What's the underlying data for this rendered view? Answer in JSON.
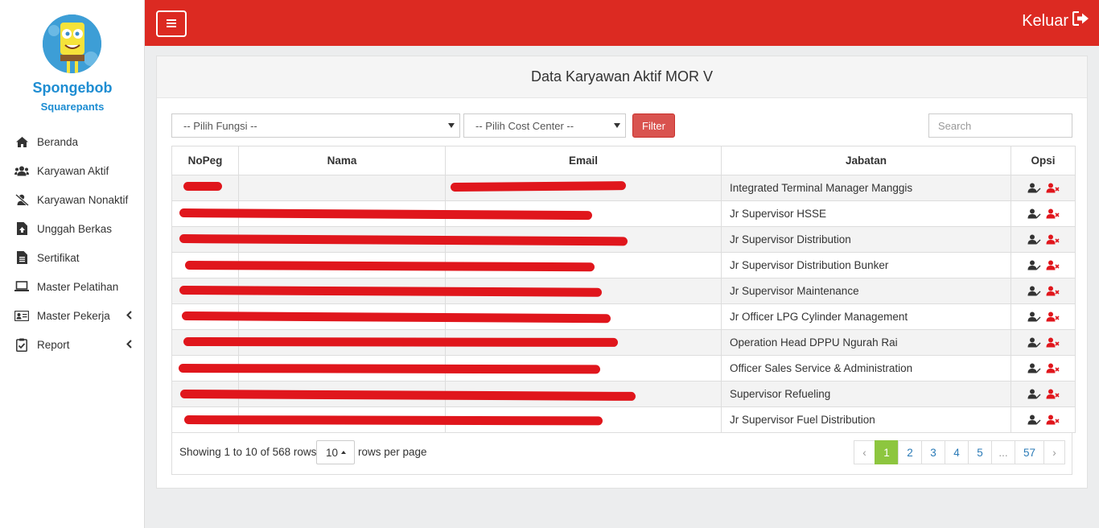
{
  "user": {
    "first_name": "Spongebob",
    "last_name": "Squarepants"
  },
  "sidebar": {
    "items": [
      {
        "label": "Beranda",
        "icon": "home-icon"
      },
      {
        "label": "Karyawan Aktif",
        "icon": "users-icon"
      },
      {
        "label": "Karyawan Nonaktif",
        "icon": "user-slash-icon"
      },
      {
        "label": "Unggah Berkas",
        "icon": "file-upload-icon"
      },
      {
        "label": "Sertifikat",
        "icon": "file-text-icon"
      },
      {
        "label": "Master Pelatihan",
        "icon": "laptop-icon"
      },
      {
        "label": "Master Pekerja",
        "icon": "id-card-icon"
      },
      {
        "label": "Report",
        "icon": "clipboard-check-icon"
      }
    ]
  },
  "topbar": {
    "logout_label": "Keluar"
  },
  "panel": {
    "title": "Data Karyawan Aktif MOR V"
  },
  "filters": {
    "fungsi_selected": "-- Pilih Fungsi --",
    "cost_center_selected": "-- Pilih Cost Center --",
    "filter_label": "Filter",
    "search_placeholder": "Search"
  },
  "table": {
    "headers": {
      "nopeg": "NoPeg",
      "nama": "Nama",
      "email": "Email",
      "jabatan": "Jabatan",
      "opsi": "Opsi"
    },
    "rows": [
      {
        "nopeg": "",
        "nama": "",
        "email": "",
        "jabatan": "Integrated Terminal Manager Manggis"
      },
      {
        "nopeg": "",
        "nama": "",
        "email": "",
        "jabatan": "Jr Supervisor HSSE"
      },
      {
        "nopeg": "",
        "nama": "",
        "email": "",
        "jabatan": "Jr Supervisor Distribution"
      },
      {
        "nopeg": "",
        "nama": "",
        "email": "",
        "jabatan": "Jr Supervisor Distribution Bunker"
      },
      {
        "nopeg": "",
        "nama": "",
        "email": "",
        "jabatan": "Jr Supervisor Maintenance"
      },
      {
        "nopeg": "",
        "nama": "",
        "email": "",
        "jabatan": "Jr Officer LPG Cylinder Management"
      },
      {
        "nopeg": "",
        "nama": "",
        "email": "",
        "jabatan": "Operation Head DPPU Ngurah Rai"
      },
      {
        "nopeg": "",
        "nama": "",
        "email": "",
        "jabatan": "Officer Sales Service & Administration"
      },
      {
        "nopeg": "",
        "nama": "",
        "email": "",
        "jabatan": "Supervisor Refueling"
      },
      {
        "nopeg": "",
        "nama": "",
        "email": "",
        "jabatan": "Jr Supervisor Fuel Distribution"
      }
    ]
  },
  "footer": {
    "showing": "Showing 1 to 10 of 568 rows",
    "page_size": "10",
    "rows_per_page": "rows per page",
    "pages": [
      "‹",
      "1",
      "2",
      "3",
      "4",
      "5",
      "...",
      "57",
      "›"
    ],
    "active_page": "1"
  },
  "colors": {
    "topbar": "#dc2a22",
    "accent_text": "#1e8dd2",
    "filter_button": "#d9534f",
    "active_page": "#8dc63f",
    "redaction": "#e0161c"
  }
}
